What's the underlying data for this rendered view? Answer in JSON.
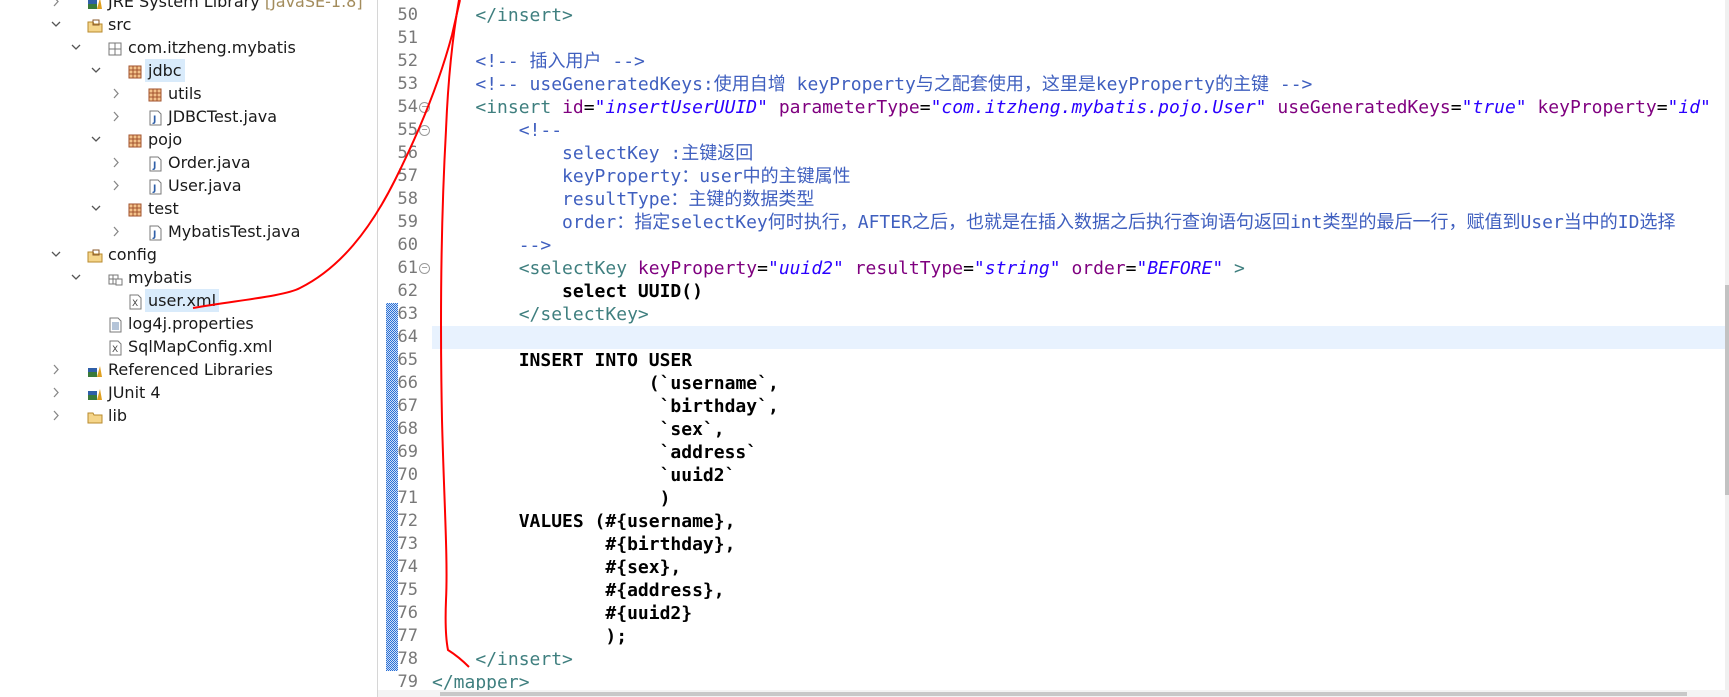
{
  "colors": {
    "tag": "#3f7f7f",
    "attribute": "#7f007f",
    "value": "#2a00ff",
    "comment": "#3f5fbf",
    "selection": "#d9ebfb",
    "current_line": "#e8f2fe",
    "annotation": "#ff0000"
  },
  "project_explorer": {
    "items": [
      {
        "label": "JRE System Library",
        "decoration": "[JavaSE-1.8]",
        "level": 1,
        "chevron": "right",
        "icon": "library-icon"
      },
      {
        "label": "src",
        "level": 1,
        "chevron": "down",
        "icon": "source-folder-icon"
      },
      {
        "label": "com.itzheng.mybatis",
        "level": 2,
        "chevron": "down",
        "icon": "empty-package-icon"
      },
      {
        "label": "jdbc",
        "level": 3,
        "chevron": "down",
        "icon": "package-icon",
        "selected": true
      },
      {
        "label": "utils",
        "level": 4,
        "chevron": "right",
        "icon": "package-icon"
      },
      {
        "label": "JDBCTest.java",
        "level": 4,
        "chevron": "right",
        "icon": "java-file-icon"
      },
      {
        "label": "pojo",
        "level": 3,
        "chevron": "down",
        "icon": "package-icon"
      },
      {
        "label": "Order.java",
        "level": 4,
        "chevron": "right",
        "icon": "java-file-icon"
      },
      {
        "label": "User.java",
        "level": 4,
        "chevron": "right",
        "icon": "java-file-icon"
      },
      {
        "label": "test",
        "level": 3,
        "chevron": "down",
        "icon": "package-icon"
      },
      {
        "label": "MybatisTest.java",
        "level": 4,
        "chevron": "right",
        "icon": "java-file-icon"
      },
      {
        "label": "config",
        "level": 1,
        "chevron": "down",
        "icon": "source-folder-icon"
      },
      {
        "label": "mybatis",
        "level": 2,
        "chevron": "down",
        "icon": "folder-package-icon"
      },
      {
        "label": "user.xml",
        "level": 3,
        "chevron": "none",
        "icon": "xml-file-icon",
        "selected": true
      },
      {
        "label": "log4j.properties",
        "level": 2,
        "chevron": "none",
        "icon": "properties-file-icon"
      },
      {
        "label": "SqlMapConfig.xml",
        "level": 2,
        "chevron": "none",
        "icon": "xml-file-icon"
      },
      {
        "label": "Referenced Libraries",
        "level": 1,
        "chevron": "right",
        "icon": "library-icon"
      },
      {
        "label": "JUnit 4",
        "level": 1,
        "chevron": "right",
        "icon": "library-icon"
      },
      {
        "label": "lib",
        "level": 1,
        "chevron": "right",
        "icon": "folder-icon"
      }
    ]
  },
  "editor": {
    "current_line": 64,
    "change_bar_lines": [
      63,
      78
    ],
    "fold_lines": [
      54,
      55,
      61
    ],
    "lines": [
      {
        "n": "50",
        "tokens": [
          [
            "    ",
            ""
          ],
          [
            "</insert>",
            "tag"
          ]
        ]
      },
      {
        "n": "51",
        "tokens": []
      },
      {
        "n": "52",
        "tokens": [
          [
            "    ",
            ""
          ],
          [
            "<!-- 插入用户 -->",
            "com"
          ]
        ]
      },
      {
        "n": "53",
        "tokens": [
          [
            "    ",
            ""
          ],
          [
            "<!-- useGeneratedKeys:使用自增 keyProperty与之配套使用，这里是keyProperty的主键 -->",
            "com"
          ]
        ]
      },
      {
        "n": "54",
        "tokens": [
          [
            "    ",
            ""
          ],
          [
            "<insert",
            "tag"
          ],
          [
            " ",
            ""
          ],
          [
            "id",
            "attr"
          ],
          [
            "=",
            "eq"
          ],
          [
            "\"insertUserUUID\"",
            "val"
          ],
          [
            " ",
            ""
          ],
          [
            "parameterType",
            "attr"
          ],
          [
            "=",
            "eq"
          ],
          [
            "\"com.itzheng.mybatis.pojo.User\"",
            "val"
          ],
          [
            " ",
            ""
          ],
          [
            "useGeneratedKeys",
            "attr"
          ],
          [
            "=",
            "eq"
          ],
          [
            "\"true\"",
            "val"
          ],
          [
            " ",
            ""
          ],
          [
            "keyProperty",
            "attr"
          ],
          [
            "=",
            "eq"
          ],
          [
            "\"id\"",
            "val"
          ]
        ]
      },
      {
        "n": "55",
        "tokens": [
          [
            "        ",
            ""
          ],
          [
            "<!--",
            "com"
          ]
        ]
      },
      {
        "n": "56",
        "tokens": [
          [
            "            ",
            ""
          ],
          [
            "selectKey :主键返回",
            "com"
          ]
        ]
      },
      {
        "n": "57",
        "tokens": [
          [
            "            ",
            ""
          ],
          [
            "keyProperty：user中的主键属性",
            "com"
          ]
        ]
      },
      {
        "n": "58",
        "tokens": [
          [
            "            ",
            ""
          ],
          [
            "resultType：主键的数据类型",
            "com"
          ]
        ]
      },
      {
        "n": "59",
        "tokens": [
          [
            "            ",
            ""
          ],
          [
            "order：指定selectKey何时执行，AFTER之后，也就是在插入数据之后执行查询语句返回int类型的最后一行，赋值到User当中的ID选择",
            "com"
          ]
        ]
      },
      {
        "n": "60",
        "tokens": [
          [
            "        ",
            ""
          ],
          [
            "-->",
            "com"
          ]
        ]
      },
      {
        "n": "61",
        "tokens": [
          [
            "        ",
            ""
          ],
          [
            "<selectKey",
            "tag"
          ],
          [
            " ",
            ""
          ],
          [
            "keyProperty",
            "attr"
          ],
          [
            "=",
            "eq"
          ],
          [
            "\"uuid2\"",
            "val"
          ],
          [
            " ",
            ""
          ],
          [
            "resultType",
            "attr"
          ],
          [
            "=",
            "eq"
          ],
          [
            "\"string\"",
            "val"
          ],
          [
            " ",
            ""
          ],
          [
            "order",
            "attr"
          ],
          [
            "=",
            "eq"
          ],
          [
            "\"BEFORE\"",
            "val"
          ],
          [
            " >",
            "tag"
          ]
        ]
      },
      {
        "n": "62",
        "tokens": [
          [
            "            ",
            ""
          ],
          [
            "select UUID()",
            "sql"
          ]
        ]
      },
      {
        "n": "63",
        "tokens": [
          [
            "        ",
            ""
          ],
          [
            "</selectKey>",
            "tag"
          ]
        ]
      },
      {
        "n": "64",
        "tokens": []
      },
      {
        "n": "65",
        "tokens": [
          [
            "        ",
            ""
          ],
          [
            "INSERT INTO USER",
            "sql"
          ]
        ]
      },
      {
        "n": "66",
        "tokens": [
          [
            "                    ",
            ""
          ],
          [
            "(`username`,",
            "sql"
          ]
        ]
      },
      {
        "n": "67",
        "tokens": [
          [
            "                     ",
            ""
          ],
          [
            "`birthday`,",
            "sql"
          ]
        ]
      },
      {
        "n": "68",
        "tokens": [
          [
            "                     ",
            ""
          ],
          [
            "`sex`,",
            "sql"
          ]
        ]
      },
      {
        "n": "69",
        "tokens": [
          [
            "                     ",
            ""
          ],
          [
            "`address`",
            "sql"
          ]
        ]
      },
      {
        "n": "70",
        "tokens": [
          [
            "                     ",
            ""
          ],
          [
            "`uuid2`",
            "sql"
          ]
        ]
      },
      {
        "n": "71",
        "tokens": [
          [
            "                     ",
            ""
          ],
          [
            ")",
            "sql"
          ]
        ]
      },
      {
        "n": "72",
        "tokens": [
          [
            "        ",
            ""
          ],
          [
            "VALUES (#{username},",
            "sql"
          ]
        ]
      },
      {
        "n": "73",
        "tokens": [
          [
            "                ",
            ""
          ],
          [
            "#{birthday},",
            "sql"
          ]
        ]
      },
      {
        "n": "74",
        "tokens": [
          [
            "                ",
            ""
          ],
          [
            "#{sex},",
            "sql"
          ]
        ]
      },
      {
        "n": "75",
        "tokens": [
          [
            "                ",
            ""
          ],
          [
            "#{address},",
            "sql"
          ]
        ]
      },
      {
        "n": "76",
        "tokens": [
          [
            "                ",
            ""
          ],
          [
            "#{uuid2}",
            "sql"
          ]
        ]
      },
      {
        "n": "77",
        "tokens": [
          [
            "                ",
            ""
          ],
          [
            ");",
            "sql"
          ]
        ]
      },
      {
        "n": "78",
        "tokens": [
          [
            "    ",
            ""
          ],
          [
            "</insert>",
            "tag"
          ]
        ]
      },
      {
        "n": "79",
        "tokens": [
          [
            "</mapper>",
            "tag"
          ]
        ]
      }
    ]
  }
}
